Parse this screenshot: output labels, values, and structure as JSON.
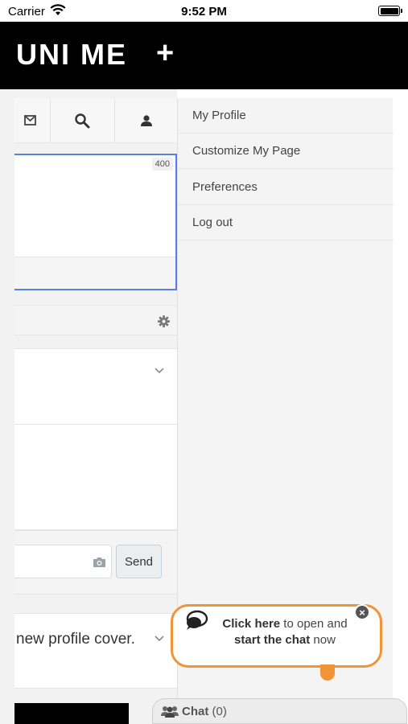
{
  "status_bar": {
    "carrier": "Carrier",
    "time": "9:52 PM",
    "battery_level": 0.95
  },
  "header": {
    "logo": "UNI ME",
    "add_symbol": "+"
  },
  "toolbar": {
    "icons": [
      "mail-icon",
      "search-icon",
      "user-icon"
    ]
  },
  "composer": {
    "char_counter": "400"
  },
  "comment": {
    "send_label": "Send"
  },
  "post": {
    "text_fragment": "new profile cover."
  },
  "menu": {
    "items": [
      {
        "label": "My Profile"
      },
      {
        "label": "Customize My Page"
      },
      {
        "label": "Preferences"
      },
      {
        "label": "Log out"
      }
    ]
  },
  "chat_popup": {
    "click_here": "Click here",
    "to_open": " to open and ",
    "start_chat": "start the chat",
    "now": " now"
  },
  "chat_bar": {
    "label": "Chat",
    "count": "(0)"
  },
  "colors": {
    "header_bg": "#000000",
    "composer_border": "#5b7de6",
    "bubble_border": "#f19438"
  }
}
